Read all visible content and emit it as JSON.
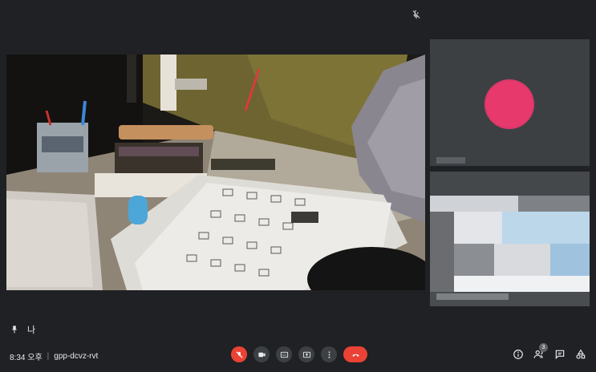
{
  "meeting": {
    "time": "8:34 오후",
    "separator": "|",
    "code": "gpp-dcvz-rvt"
  },
  "self": {
    "name": "나"
  },
  "tiles": {
    "avatar_initial": "",
    "avatar_color": "#e8396c"
  },
  "people": {
    "count": "3"
  },
  "icons": {
    "top": "mic-off-icon",
    "controls": [
      "mic-off-icon",
      "camera-icon",
      "captions-icon",
      "present-icon",
      "more-icon",
      "hangup-icon"
    ],
    "right": [
      "info-icon",
      "people-icon",
      "chat-icon",
      "activities-icon"
    ]
  },
  "colors": {
    "background": "#202124",
    "tile": "#3c4043",
    "danger": "#ea4335"
  }
}
